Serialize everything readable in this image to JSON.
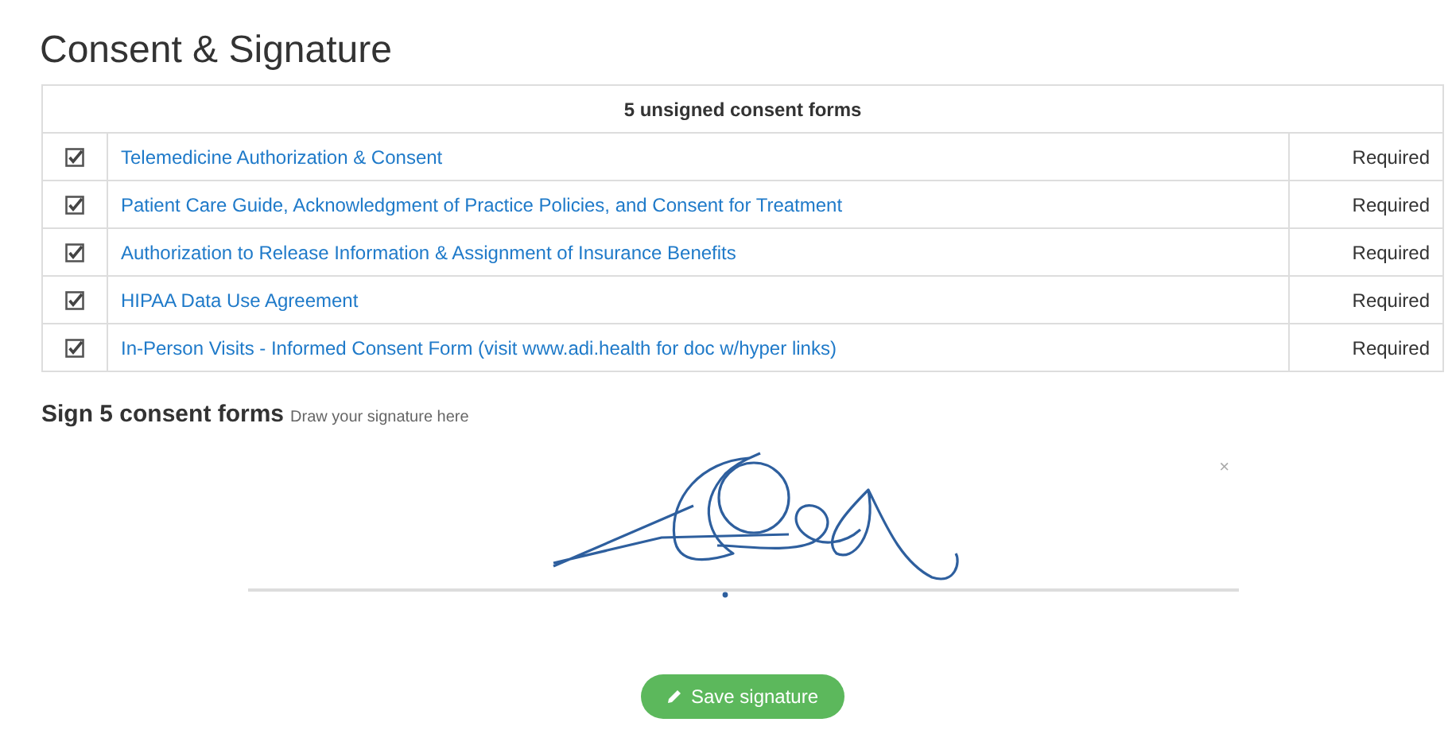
{
  "title": "Consent & Signature",
  "table": {
    "header": "5 unsigned consent forms",
    "rows": [
      {
        "checked": true,
        "name": "Telemedicine Authorization & Consent",
        "status": "Required"
      },
      {
        "checked": true,
        "name": "Patient Care Guide, Acknowledgment of Practice Policies, and Consent for Treatment",
        "status": "Required"
      },
      {
        "checked": true,
        "name": "Authorization to Release Information & Assignment of Insurance Benefits",
        "status": "Required"
      },
      {
        "checked": true,
        "name": "HIPAA Data Use Agreement",
        "status": "Required"
      },
      {
        "checked": true,
        "name": "In-Person Visits - Informed Consent Form (visit www.adi.health for doc w/hyper links)",
        "status": "Required"
      }
    ]
  },
  "signature": {
    "heading": "Sign 5 consent forms",
    "hint": "Draw your signature here",
    "clear": "×"
  },
  "save_button": "Save signature"
}
